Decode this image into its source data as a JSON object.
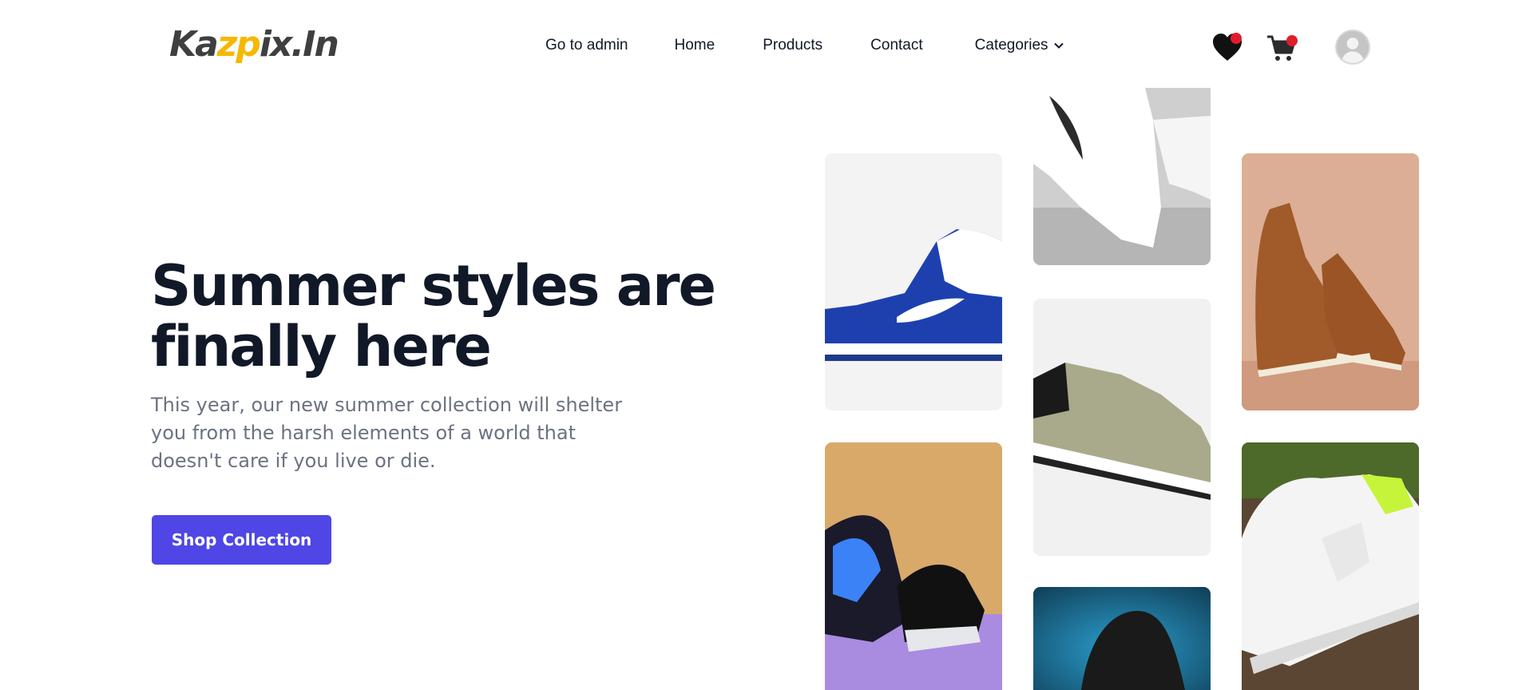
{
  "header": {
    "logo": {
      "text_main_1": "Ka",
      "text_accent": "zp",
      "text_main_2": "ix.In"
    },
    "nav": {
      "admin": "Go to admin",
      "home": "Home",
      "products": "Products",
      "contact": "Contact",
      "categories": "Categories"
    },
    "icons": {
      "wishlist": "heart-icon",
      "cart": "cart-icon",
      "avatar": "user-avatar-icon",
      "categories_toggle": "chevron-down-icon"
    },
    "badge_color": "#e11d2b"
  },
  "hero": {
    "title_line_1": "Summer styles are",
    "title_line_2": "finally here",
    "text": "This year, our new summer collection will shelter you from the harsh elements of a world that doesn't care if you live or die.",
    "cta": "Shop Collection"
  },
  "theme": {
    "accent": "#4f46e5",
    "heading": "#111827",
    "body_text": "#6b7280",
    "logo_accent": "#f5b800"
  },
  "gallery": [
    {
      "name": "blue-white-high-top-sneaker"
    },
    {
      "name": "white-sneaker-feather-print"
    },
    {
      "name": "brown-leather-shoes"
    },
    {
      "name": "black-blue-running-shoes"
    },
    {
      "name": "olive-grey-running-shoe"
    },
    {
      "name": "black-sneaker-blue-background"
    },
    {
      "name": "white-neon-sneakers"
    }
  ]
}
